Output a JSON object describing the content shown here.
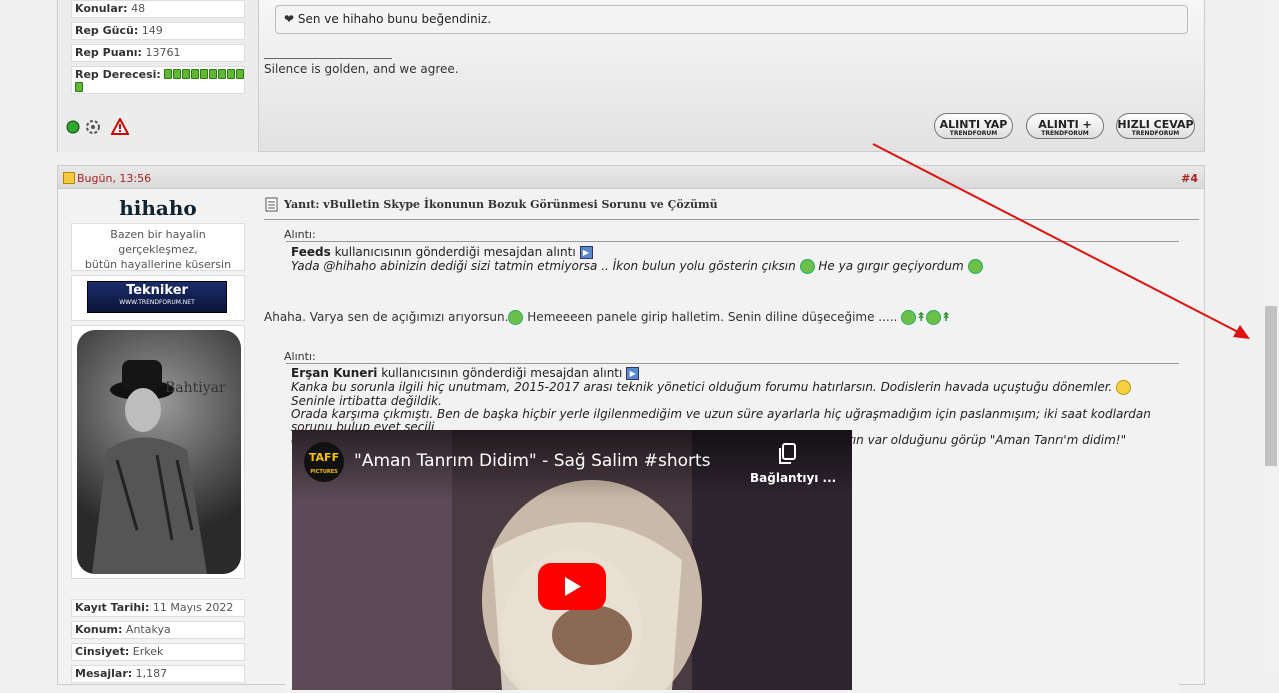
{
  "prev_post": {
    "stats": [
      {
        "label": "Konular:",
        "value": "48"
      },
      {
        "label": "Rep Gücü:",
        "value": "149"
      },
      {
        "label": "Rep Puanı:",
        "value": "13761"
      },
      {
        "label": "Rep Derecesi:",
        "value": ""
      }
    ],
    "like_text": "Sen ve hihaho bunu beğendiniz.",
    "signature": "Silence is golden, and we agree.",
    "buttons": [
      {
        "label": "ALINTI YAP",
        "sub": "TRENDFORUM"
      },
      {
        "label": "ALINTI +",
        "sub": "TRENDFORUM"
      },
      {
        "label": "HIZLI CEVAP",
        "sub": "TRENDFORUM"
      }
    ]
  },
  "post": {
    "date": "Bugün, 13:56",
    "number": "#4",
    "username": "hihaho",
    "user_title_1": "Bazen bir hayalin gerçekleşmez,",
    "user_title_2": "bütün hayallerine küsersin",
    "rank_badge": "Tekniker",
    "rank_site": "WWW.TRENDFORUM.NET",
    "avatar_text": "Bahtiyar",
    "details": [
      {
        "label": "Kayıt Tarihi:",
        "value": "11 Mayıs 2022"
      },
      {
        "label": "Konum:",
        "value": "Antakya"
      },
      {
        "label": "Cinsiyet:",
        "value": "Erkek"
      },
      {
        "label": "Mesajlar:",
        "value": "1,187"
      }
    ],
    "title": "Yanıt: vBulletin Skype İkonunun Bozuk Görünmesi Sorunu ve Çözümü",
    "quote1": {
      "label": "Alıntı:",
      "author": "Feeds",
      "suffix": "kullanıcısının gönderdiği mesajdan alıntı",
      "text_a": "Yada @hihaho abinizin dediği sizi tatmin etmiyorsa .. İkon bulun yolu gösterin çıksın",
      "text_b": "He ya gırgır geçiyordum"
    },
    "body_a": "Ahaha. Varya sen de açığımızı arıyorsun.",
    "body_b": "Hemeeeen panele girip halletim. Senin diline düşeceğime .....",
    "quote2": {
      "label": "Alıntı:",
      "author": "Erşan Kuneri",
      "suffix": "kullanıcısının gönderdiği mesajdan alıntı",
      "line1": "Kanka bu sorunla ilgili hiç unutmam, 2015-2017 arası teknik yönetici olduğum forumu hatırlarsın. Dodislerin havada uçuştuğu dönemler.",
      "line1b": "Seninle irtibatta değildik.",
      "line2": "Orada karşıma çıkmıştı. Ben de başka hiçbir yerle ilgilenmediğim ve uzun süre ayarlarla hiç uğraşmadığım için paslanmışım; iki saat kodlardan sorunu bulup evet seçili",
      "line3": "olmasına rağmen o şekilde kodlarla uğraşarak düzelttikten sonra vBulletin seçeneklerde ayarın var olduğunu görüp \"Aman Tanrı'm didim!\""
    },
    "video": {
      "channel": "TAFF",
      "channel_sub": "PICTURES",
      "title": "\"Aman Tanrım Didim\" - Sağ Salim #shorts",
      "copy_label": "Bağlantıyı ..."
    }
  },
  "colors": {
    "accent_red": "#aa2222",
    "arrow": "#e01010",
    "youtube_red": "#ff0000"
  }
}
